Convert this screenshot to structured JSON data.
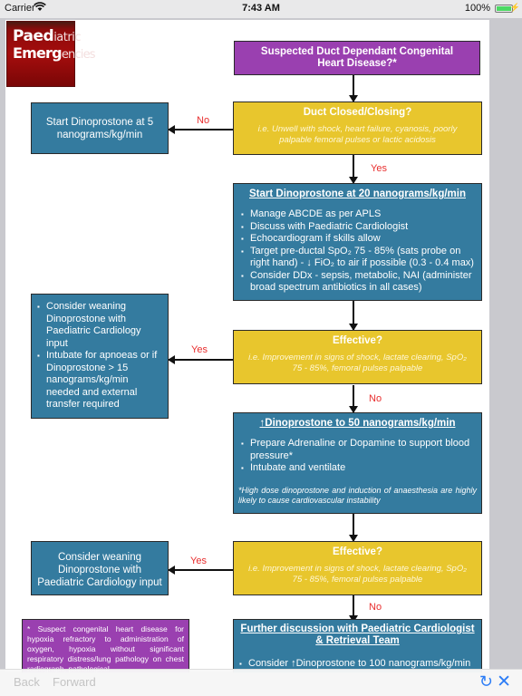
{
  "status_bar": {
    "carrier": "Carrier",
    "wifi_icon": "wifi-icon",
    "time": "7:43 AM",
    "battery_percent": "100%",
    "battery_level": 1.0,
    "charging_icon": "⚡"
  },
  "logo": {
    "line1_bold": "Paed",
    "line1_thin": "iatric",
    "line2_bold": "Emerg",
    "line2_thin": "encies"
  },
  "colors": {
    "start_node": "#9a40b0",
    "decision_node": "#e8c62d",
    "action_node": "#347b9f",
    "branch_label": "#e82e2e",
    "toolbar_accent": "#2b7cf6"
  },
  "flowchart": {
    "start": {
      "title": "Suspected Duct Dependant Congenital Heart Disease?*"
    },
    "decision1": {
      "title": "Duct Closed/Closing?",
      "subtitle": "i.e. Unwell with shock, heart failure, cyanosis, poorly palpable femoral pulses or lactic acidosis",
      "no_label": "No",
      "yes_label": "Yes"
    },
    "no_action1": {
      "text": "Start Dinoprostone at 5 nanograms/kg/min"
    },
    "action1": {
      "title": "Start Dinoprostone at 20 nanograms/kg/min",
      "bullets": [
        "Manage ABCDE as per APLS",
        "Discuss with Paediatric Cardiologist",
        "Echocardiogram if skills allow",
        "Target pre-ductal SpO₂ 75 - 85% (sats probe on right hand) - ↓ FiO₂ to air if possible (0.3 - 0.4 max)",
        "Consider DDx - sepsis, metabolic, NAI (administer broad spectrum antibiotics in all cases)"
      ]
    },
    "decision2": {
      "title": "Effective?",
      "subtitle": "i.e. Improvement in signs of shock, lactate clearing, SpO₂ 75 - 85%, femoral  pulses palpable",
      "yes_label": "Yes",
      "no_label": "No"
    },
    "yes_action2": {
      "bullets": [
        "Consider weaning Dinoprostone with Paediatric Cardiology input",
        "Intubate for apnoeas or if Dinoprostone > 15 nanograms/kg/min needed and external transfer required"
      ]
    },
    "action2": {
      "title": "↑Dinoprostone to 50 nanograms/kg/min",
      "bullets": [
        "Prepare Adrenaline or Dopamine to support blood pressure*",
        "Intubate and ventilate"
      ],
      "note": "*High dose dinoprostone and induction of anaesthesia are highly likely to cause cardiovascular instability"
    },
    "decision3": {
      "title": "Effective?",
      "subtitle": "i.e. Improvement in signs of shock, lactate clearing, SpO₂ 75 - 85%, femoral  pulses palpable",
      "yes_label": "Yes",
      "no_label": "No"
    },
    "yes_action3": {
      "text": "Consider weaning Dinoprostone with Paediatric Cardiology input"
    },
    "action3": {
      "title": "Further discussion with Paediatric Cardiologist & Retrieval Team",
      "bullets": [
        "Consider ↑Dinoprostone to 100 nanograms/kg/min"
      ]
    },
    "footnote": "* Suspect congenital heart disease for hypoxia refractory to administration of oxygen, hypoxia without significant respiratory distress/lung pathology on chest radiograph, pathological"
  },
  "toolbar": {
    "back": "Back",
    "forward": "Forward",
    "refresh_icon": "↻",
    "close_icon": "✕"
  }
}
